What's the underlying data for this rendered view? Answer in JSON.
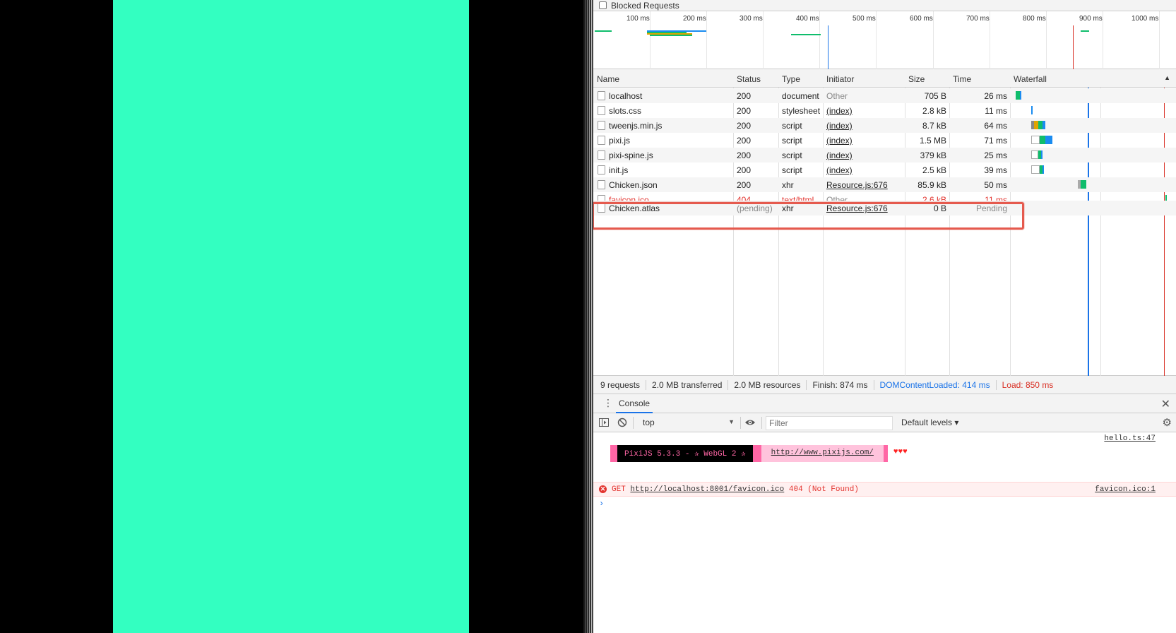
{
  "network": {
    "blocked_requests_label": "Blocked Requests",
    "overview_ticks": [
      "100 ms",
      "200 ms",
      "300 ms",
      "400 ms",
      "500 ms",
      "600 ms",
      "700 ms",
      "800 ms",
      "900 ms",
      "1000 ms"
    ],
    "columns": [
      "Name",
      "Status",
      "Type",
      "Initiator",
      "Size",
      "Time",
      "Waterfall"
    ],
    "rows": [
      {
        "name": "localhost",
        "status": "200",
        "type": "document",
        "initiator": "Other",
        "size": "705 B",
        "time": "26 ms"
      },
      {
        "name": "slots.css",
        "status": "200",
        "type": "stylesheet",
        "initiator": "(index)",
        "size": "2.8 kB",
        "time": "11 ms"
      },
      {
        "name": "tweenjs.min.js",
        "status": "200",
        "type": "script",
        "initiator": "(index)",
        "size": "8.7 kB",
        "time": "64 ms"
      },
      {
        "name": "pixi.js",
        "status": "200",
        "type": "script",
        "initiator": "(index)",
        "size": "1.5 MB",
        "time": "71 ms"
      },
      {
        "name": "pixi-spine.js",
        "status": "200",
        "type": "script",
        "initiator": "(index)",
        "size": "379 kB",
        "time": "25 ms"
      },
      {
        "name": "init.js",
        "status": "200",
        "type": "script",
        "initiator": "(index)",
        "size": "2.5 kB",
        "time": "39 ms"
      },
      {
        "name": "Chicken.json",
        "status": "200",
        "type": "xhr",
        "initiator": "Resource.js:676",
        "size": "85.9 kB",
        "time": "50 ms"
      },
      {
        "name": "favicon.ico",
        "status": "404",
        "type": "text/html",
        "initiator": "Other",
        "size": "2.6 kB",
        "time": "11 ms"
      },
      {
        "name": "Chicken.atlas",
        "status": "(pending)",
        "type": "xhr",
        "initiator": "Resource.js:676",
        "size": "0 B",
        "time": "Pending"
      }
    ],
    "summary": {
      "requests": "9 requests",
      "transferred": "2.0 MB transferred",
      "resources": "2.0 MB resources",
      "finish": "Finish: 874 ms",
      "dom_content_loaded": "DOMContentLoaded: 414 ms",
      "load": "Load: 850 ms"
    },
    "colors": {
      "dcl_line": "#1a73e8",
      "load_line": "#d93025",
      "highlight": "#e55a4e",
      "waterfall_green": "#0fbd6c",
      "waterfall_blue": "#1a8cf0"
    }
  },
  "console": {
    "tab_label": "Console",
    "context_value": "top",
    "filter_placeholder": "Filter",
    "levels_label": "Default levels ▾",
    "pixi_banner": "PixiJS 5.3.3 - ✰ WebGL 2 ✰",
    "pixi_link": "http://www.pixijs.com/",
    "pixi_hearts": "♥♥♥",
    "pixi_source": "hello.ts:47",
    "error_method": "GET",
    "error_url": "http://localhost:8001/favicon.ico",
    "error_status": "404 (Not Found)",
    "error_source": "favicon.ico:1",
    "prompt": "›"
  },
  "page": {
    "canvas_color": "#33ffc1"
  }
}
